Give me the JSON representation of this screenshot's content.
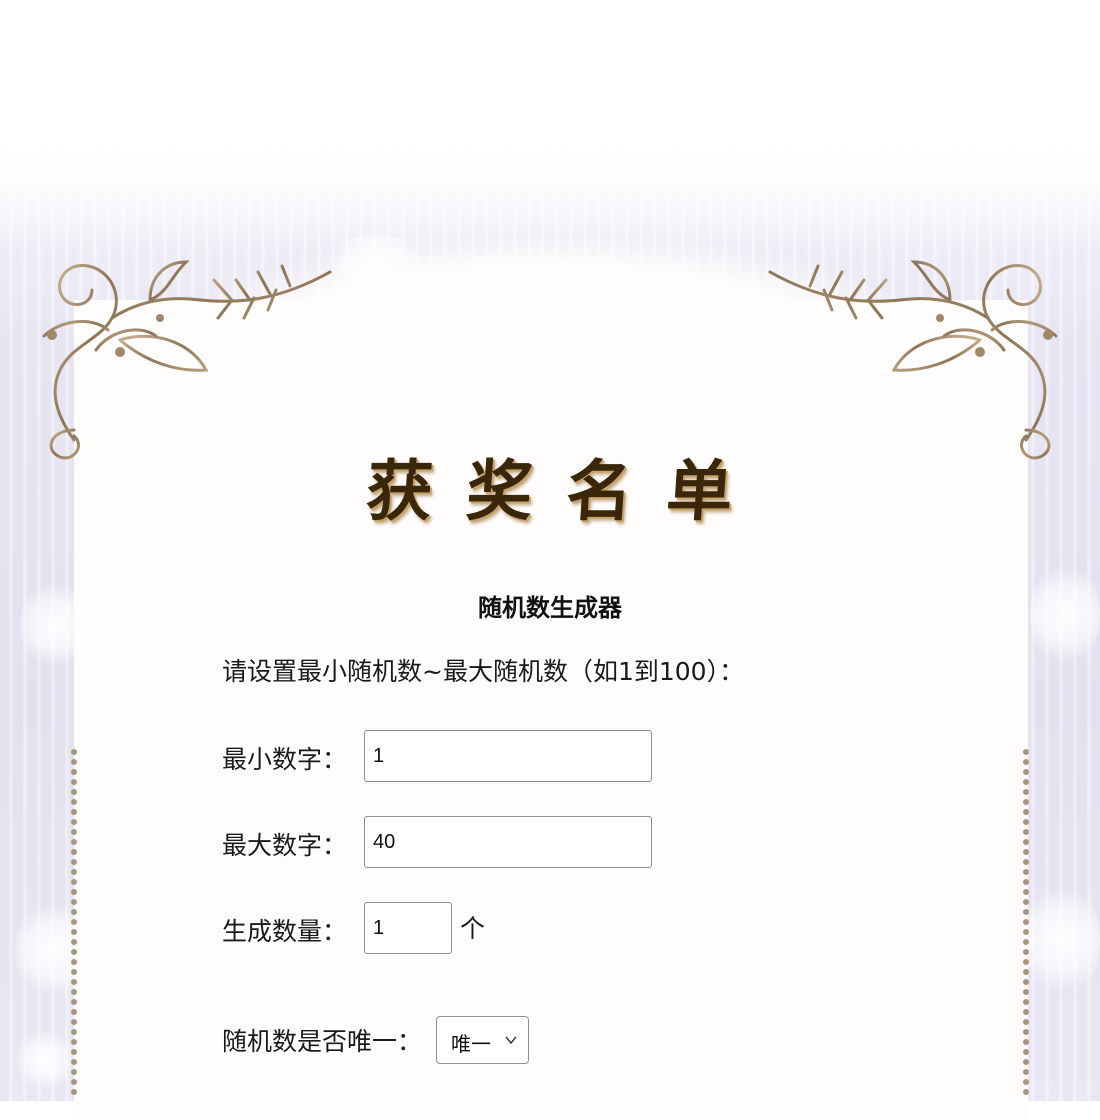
{
  "header": {
    "title": "获奖名单"
  },
  "form": {
    "heading": "随机数生成器",
    "instruction": "请设置最小随机数~最大随机数（如1到100）：",
    "min": {
      "label": "最小数字：",
      "value": "1"
    },
    "max": {
      "label": "最大数字：",
      "value": "40"
    },
    "count": {
      "label": "生成数量：",
      "value": "1",
      "unit": "个"
    },
    "unique": {
      "label": "随机数是否唯一：",
      "selected": "唯一"
    }
  },
  "colors": {
    "title_ink": "#3a2608",
    "frame_gold": "#a08868",
    "paper": "#fffdfb",
    "backdrop": "#e5e3f0"
  },
  "icons": {
    "select_arrow": "chevron-down-icon",
    "corner_ornament": "floral-scroll-ornament"
  }
}
